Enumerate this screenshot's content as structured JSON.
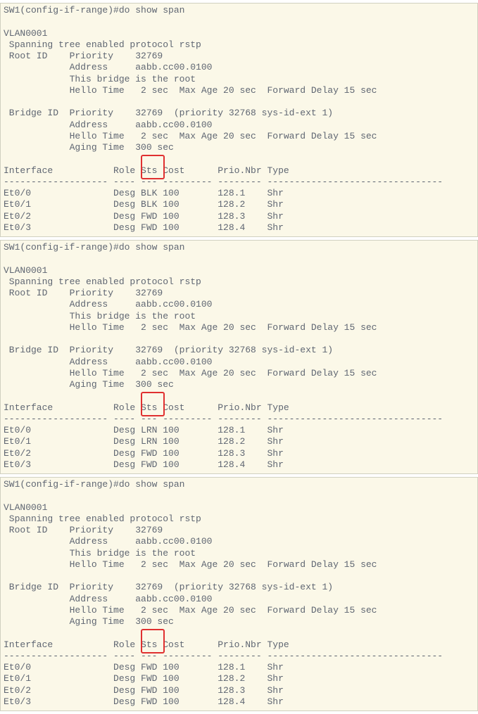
{
  "panels": [
    {
      "prompt": "SW1(config-if-range)#do show span",
      "vlan": "VLAN0001",
      "stp_line": " Spanning tree enabled protocol rstp",
      "root_priority": " Root ID    Priority    32769",
      "root_address": "            Address     aabb.cc00.0100",
      "root_is": "            This bridge is the root",
      "root_hello": "            Hello Time   2 sec  Max Age 20 sec  Forward Delay 15 sec",
      "bridge_priority": " Bridge ID  Priority    32769  (priority 32768 sys-id-ext 1)",
      "bridge_address": "            Address     aabb.cc00.0100",
      "bridge_hello": "            Hello Time   2 sec  Max Age 20 sec  Forward Delay 15 sec",
      "bridge_aging": "            Aging Time  300 sec",
      "hdr": "Interface           Role Sts Cost      Prio.Nbr Type",
      "sep": "------------------- ---- --- --------- -------- --------------------------------",
      "rows": [
        "Et0/0               Desg BLK 100       128.1    Shr",
        "Et0/1               Desg BLK 100       128.2    Shr",
        "Et0/2               Desg FWD 100       128.3    Shr",
        "Et0/3               Desg FWD 100       128.4    Shr"
      ],
      "chart_data": {
        "type": "table",
        "columns": [
          "Interface",
          "Role",
          "Sts",
          "Cost",
          "Prio.Nbr",
          "Type"
        ],
        "data": [
          [
            "Et0/0",
            "Desg",
            "BLK",
            100,
            "128.1",
            "Shr"
          ],
          [
            "Et0/1",
            "Desg",
            "BLK",
            100,
            "128.2",
            "Shr"
          ],
          [
            "Et0/2",
            "Desg",
            "FWD",
            100,
            "128.3",
            "Shr"
          ],
          [
            "Et0/3",
            "Desg",
            "FWD",
            100,
            "128.4",
            "Shr"
          ]
        ],
        "highlight_rows": [
          0,
          1
        ],
        "highlight_col": "Sts"
      }
    },
    {
      "prompt": "SW1(config-if-range)#do show span",
      "vlan": "VLAN0001",
      "stp_line": " Spanning tree enabled protocol rstp",
      "root_priority": " Root ID    Priority    32769",
      "root_address": "            Address     aabb.cc00.0100",
      "root_is": "            This bridge is the root",
      "root_hello": "            Hello Time   2 sec  Max Age 20 sec  Forward Delay 15 sec",
      "bridge_priority": " Bridge ID  Priority    32769  (priority 32768 sys-id-ext 1)",
      "bridge_address": "            Address     aabb.cc00.0100",
      "bridge_hello": "            Hello Time   2 sec  Max Age 20 sec  Forward Delay 15 sec",
      "bridge_aging": "            Aging Time  300 sec",
      "hdr": "Interface           Role Sts Cost      Prio.Nbr Type",
      "sep": "------------------- ---- --- --------- -------- --------------------------------",
      "rows": [
        "Et0/0               Desg LRN 100       128.1    Shr",
        "Et0/1               Desg LRN 100       128.2    Shr",
        "Et0/2               Desg FWD 100       128.3    Shr",
        "Et0/3               Desg FWD 100       128.4    Shr"
      ],
      "chart_data": {
        "type": "table",
        "columns": [
          "Interface",
          "Role",
          "Sts",
          "Cost",
          "Prio.Nbr",
          "Type"
        ],
        "data": [
          [
            "Et0/0",
            "Desg",
            "LRN",
            100,
            "128.1",
            "Shr"
          ],
          [
            "Et0/1",
            "Desg",
            "LRN",
            100,
            "128.2",
            "Shr"
          ],
          [
            "Et0/2",
            "Desg",
            "FWD",
            100,
            "128.3",
            "Shr"
          ],
          [
            "Et0/3",
            "Desg",
            "FWD",
            100,
            "128.4",
            "Shr"
          ]
        ],
        "highlight_rows": [
          0,
          1
        ],
        "highlight_col": "Sts"
      }
    },
    {
      "prompt": "SW1(config-if-range)#do show span",
      "vlan": "VLAN0001",
      "stp_line": " Spanning tree enabled protocol rstp",
      "root_priority": " Root ID    Priority    32769",
      "root_address": "            Address     aabb.cc00.0100",
      "root_is": "            This bridge is the root",
      "root_hello": "            Hello Time   2 sec  Max Age 20 sec  Forward Delay 15 sec",
      "bridge_priority": " Bridge ID  Priority    32769  (priority 32768 sys-id-ext 1)",
      "bridge_address": "            Address     aabb.cc00.0100",
      "bridge_hello": "            Hello Time   2 sec  Max Age 20 sec  Forward Delay 15 sec",
      "bridge_aging": "            Aging Time  300 sec",
      "hdr": "Interface           Role Sts Cost      Prio.Nbr Type",
      "sep": "------------------- ---- --- --------- -------- --------------------------------",
      "rows": [
        "Et0/0               Desg FWD 100       128.1    Shr",
        "Et0/1               Desg FWD 100       128.2    Shr",
        "Et0/2               Desg FWD 100       128.3    Shr",
        "Et0/3               Desg FWD 100       128.4    Shr"
      ],
      "chart_data": {
        "type": "table",
        "columns": [
          "Interface",
          "Role",
          "Sts",
          "Cost",
          "Prio.Nbr",
          "Type"
        ],
        "data": [
          [
            "Et0/0",
            "Desg",
            "FWD",
            100,
            "128.1",
            "Shr"
          ],
          [
            "Et0/1",
            "Desg",
            "FWD",
            100,
            "128.2",
            "Shr"
          ],
          [
            "Et0/2",
            "Desg",
            "FWD",
            100,
            "128.3",
            "Shr"
          ],
          [
            "Et0/3",
            "Desg",
            "FWD",
            100,
            "128.4",
            "Shr"
          ]
        ],
        "highlight_rows": [
          0,
          1
        ],
        "highlight_col": "Sts"
      }
    }
  ]
}
